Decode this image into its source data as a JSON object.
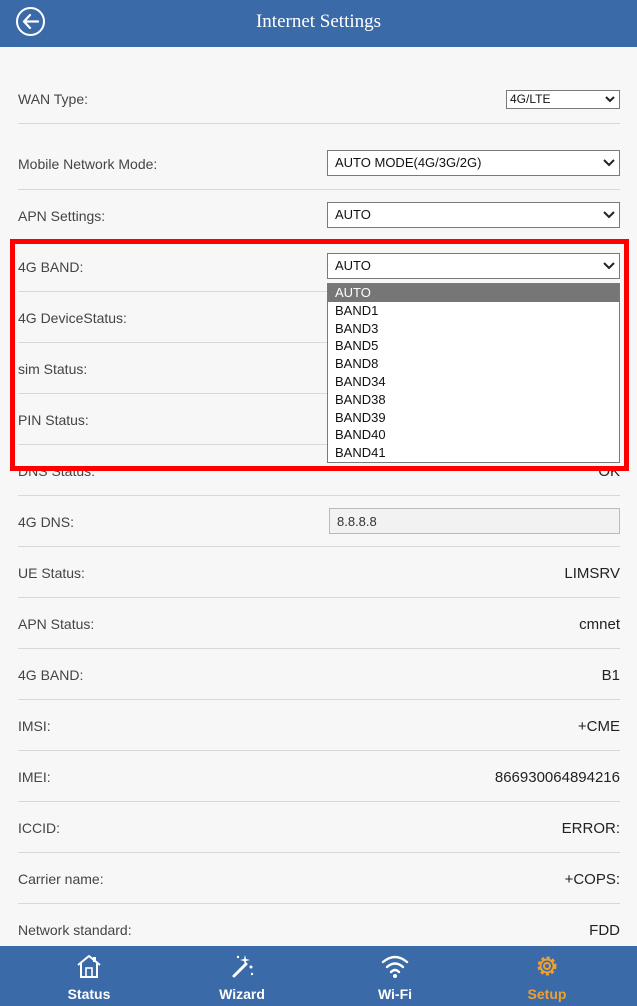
{
  "header": {
    "title": "Internet Settings"
  },
  "form": {
    "wan_type": {
      "label": "WAN Type:",
      "value": "4G/LTE"
    },
    "mobile_network_mode": {
      "label": "Mobile Network Mode:",
      "value": "AUTO MODE(4G/3G/2G)"
    },
    "apn_settings": {
      "label": "APN Settings:",
      "value": "AUTO"
    },
    "band": {
      "label": "4G BAND:",
      "value": "AUTO",
      "options": [
        "AUTO",
        "BAND1",
        "BAND3",
        "BAND5",
        "BAND8",
        "BAND34",
        "BAND38",
        "BAND39",
        "BAND40",
        "BAND41"
      ]
    },
    "device_status": {
      "label": "4G DeviceStatus:"
    },
    "sim_status": {
      "label": "sim Status:"
    },
    "pin_status": {
      "label": "PIN Status:"
    },
    "dns_status": {
      "label": "DNS Status:",
      "value": "OK"
    },
    "dns": {
      "label": "4G DNS:",
      "value": "8.8.8.8"
    },
    "ue_status": {
      "label": "UE Status:",
      "value": "LIMSRV"
    },
    "apn_status": {
      "label": "APN Status:",
      "value": "cmnet"
    },
    "band_info": {
      "label": "4G BAND:",
      "value": "B1"
    },
    "imsi": {
      "label": "IMSI:",
      "value": "+CME"
    },
    "imei": {
      "label": "IMEI:",
      "value": "866930064894216"
    },
    "iccid": {
      "label": "ICCID:",
      "value": "ERROR:"
    },
    "carrier": {
      "label": "Carrier name:",
      "value": "+COPS:"
    },
    "network_standard": {
      "label": "Network standard:",
      "value": "FDD"
    }
  },
  "nav": {
    "status": "Status",
    "wizard": "Wizard",
    "wifi": "Wi-Fi",
    "setup": "Setup"
  },
  "colors": {
    "header_bg": "#3a6aa8",
    "active_tab": "#f0a030",
    "highlight": "#ff0000"
  }
}
